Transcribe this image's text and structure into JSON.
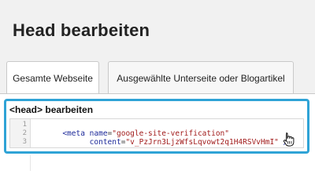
{
  "page": {
    "title": "Head bearbeiten"
  },
  "tabs": [
    {
      "label": "Gesamte Webseite",
      "selected": true
    },
    {
      "label": "Ausgewählte Unterseite oder Blogartikel",
      "selected": false
    }
  ],
  "panel": {
    "label": "<head> bearbeiten",
    "accent_color": "#2fa3d6"
  },
  "editor": {
    "line_numbers": [
      "1",
      "2",
      "3"
    ],
    "lines": [
      {
        "open": "<meta ",
        "attr": "name",
        "eq": "=",
        "value": "\"google-site-verification\""
      },
      {
        "indent": "      ",
        "attr": "content",
        "eq": "=",
        "value": "\"v_PzJrn3LjzWfsLqvowt2q1H4RSVvHmI\"",
        "close": " />"
      },
      {
        "text": ""
      }
    ]
  },
  "cursor": {
    "icon": "hand-pointer-icon"
  }
}
